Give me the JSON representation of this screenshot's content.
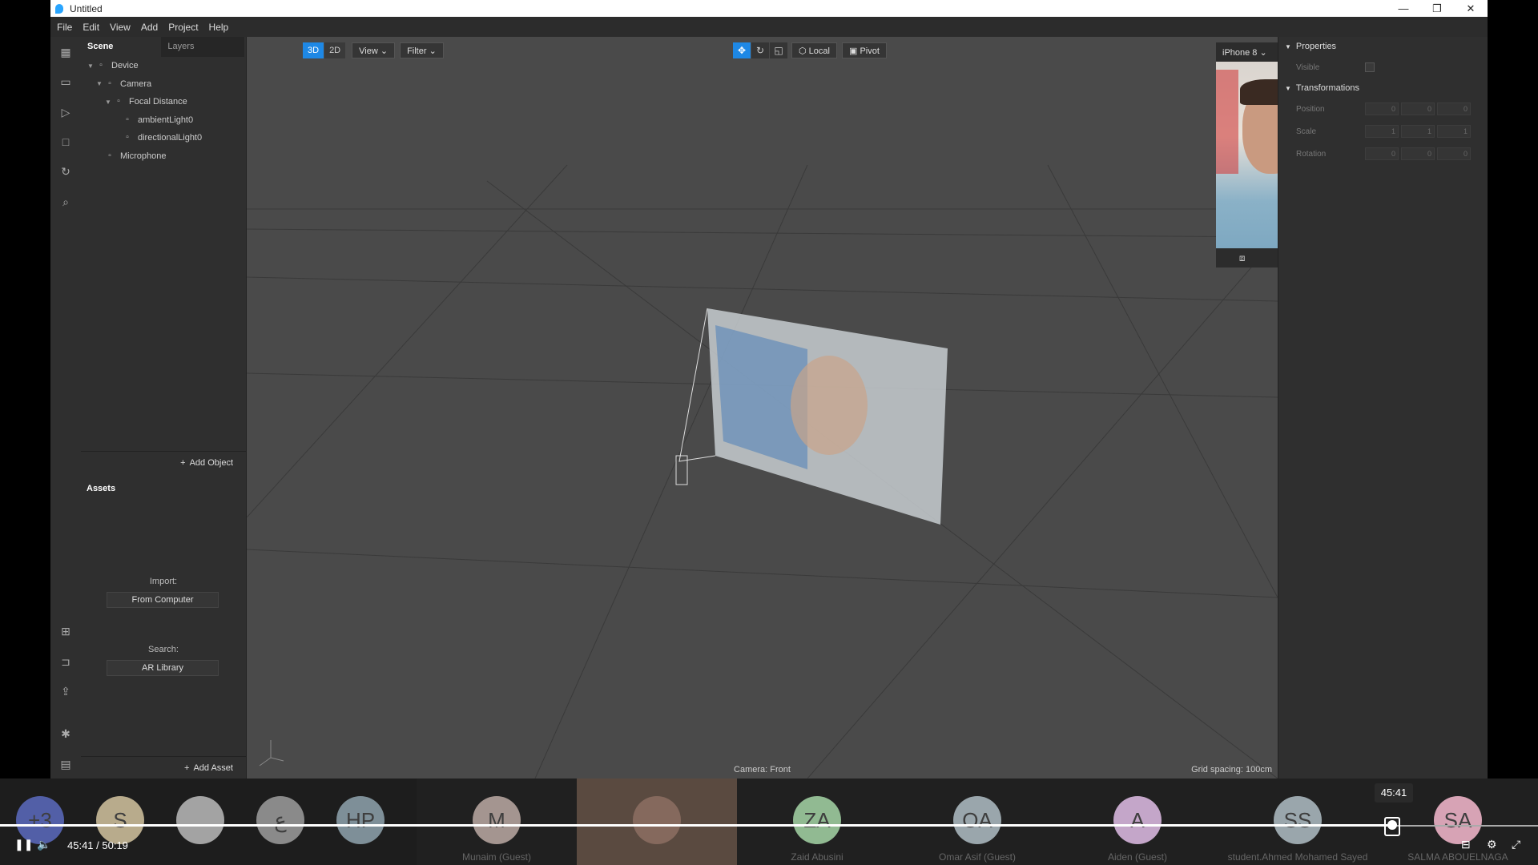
{
  "window": {
    "title": "Untitled",
    "min": "—",
    "max": "❐",
    "close": "✕"
  },
  "menu": [
    "File",
    "Edit",
    "View",
    "Add",
    "Project",
    "Help"
  ],
  "scene": {
    "tab_scene": "Scene",
    "tab_layers": "Layers",
    "tree": [
      {
        "label": "Device",
        "indent": 0,
        "expanded": true,
        "icon": "device-icon"
      },
      {
        "label": "Camera",
        "indent": 1,
        "expanded": true,
        "icon": "camera-icon"
      },
      {
        "label": "Focal Distance",
        "indent": 2,
        "expanded": true,
        "icon": "focal-distance-icon"
      },
      {
        "label": "ambientLight0",
        "indent": 3,
        "expanded": null,
        "icon": "ambient-light-icon"
      },
      {
        "label": "directionalLight0",
        "indent": 3,
        "expanded": null,
        "icon": "directional-light-icon"
      },
      {
        "label": "Microphone",
        "indent": 1,
        "expanded": null,
        "icon": "microphone-icon"
      }
    ],
    "add_object": "Add Object"
  },
  "assets": {
    "title": "Assets",
    "import_label": "Import:",
    "import_button": "From Computer",
    "search_label": "Search:",
    "search_button": "AR Library",
    "add_asset": "Add Asset"
  },
  "viewport": {
    "mode_3d": "3D",
    "mode_2d": "2D",
    "view": "View",
    "filter": "Filter",
    "local": "Local",
    "pivot": "Pivot",
    "camera_label": "Camera: Front",
    "grid_label": "Grid spacing: 100cm"
  },
  "preview": {
    "device": "iPhone 8"
  },
  "properties": {
    "title": "Properties",
    "visible": "Visible",
    "transform_title": "Transformations",
    "rows": [
      {
        "name": "Position",
        "values": [
          "0",
          "0",
          "0"
        ]
      },
      {
        "name": "Scale",
        "values": [
          "1",
          "1",
          "1"
        ]
      },
      {
        "name": "Rotation",
        "values": [
          "0",
          "0",
          "0"
        ]
      }
    ]
  },
  "meeting": {
    "tiles": [
      {
        "initials": "+3",
        "name": "",
        "color": "#5c6bc0"
      },
      {
        "initials": "S",
        "name": "",
        "color": "#d4c4a0"
      },
      {
        "initials": "",
        "name": "",
        "color": "#bbbbbb"
      },
      {
        "initials": "ع",
        "name": "",
        "color": "#9e9e9e"
      },
      {
        "initials": "HP",
        "name": "",
        "color": "#90a4ae"
      },
      {
        "initials": "M",
        "name": "Munaim (Guest)",
        "color": "#bcaaa4"
      },
      {
        "initials": "",
        "name": "",
        "color": "#8d6e63"
      },
      {
        "initials": "ZA",
        "name": "Zaid Abusini",
        "color": "#a5d6a7"
      },
      {
        "initials": "OA",
        "name": "Omar Asif (Guest)",
        "color": "#b0bec5"
      },
      {
        "initials": "A",
        "name": "Aiden (Guest)",
        "color": "#e1bee7"
      },
      {
        "initials": "SS",
        "name": "student.Ahmed Mohamed Sayed",
        "color": "#b0bec5"
      },
      {
        "initials": "SA",
        "name": "SALMA ABOUELNAGA",
        "color": "#f8bbd0"
      }
    ]
  },
  "player": {
    "current": "45:41",
    "duration": "50:19",
    "time_display": "45:41  /  50:19",
    "tooltip": "45:41",
    "progress": 0.908
  }
}
